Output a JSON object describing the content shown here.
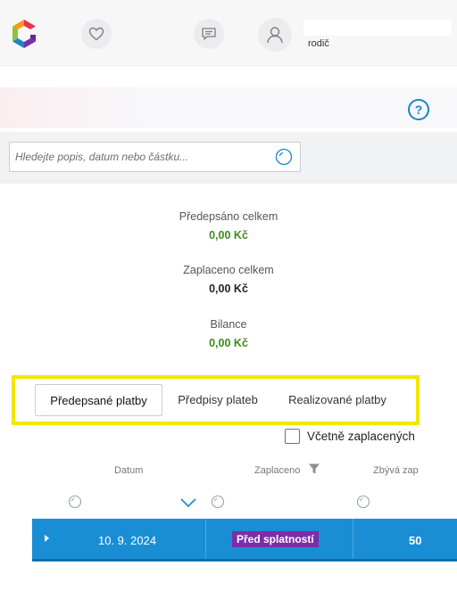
{
  "header": {
    "user_role": "rodič",
    "brand_colors": [
      "#e8334a",
      "#f39a1e",
      "#8bc53f",
      "#1a86c8",
      "#7c2ea8"
    ]
  },
  "panel": {
    "help_symbol": "?"
  },
  "search": {
    "placeholder": "Hledejte popis, datum nebo částku..."
  },
  "summary": {
    "prescribed_label": "Předepsáno celkem",
    "prescribed_value": "0,00 Kč",
    "paid_label": "Zaplaceno celkem",
    "paid_value": "0,00 Kč",
    "balance_label": "Bilance",
    "balance_value": "0,00 Kč"
  },
  "tabs": [
    {
      "label": "Předepsané platby",
      "active": true
    },
    {
      "label": "Předpisy plateb",
      "active": false
    },
    {
      "label": "Realizované platby",
      "active": false
    }
  ],
  "filter": {
    "include_paid_label": "Včetně zaplacených",
    "checked": false
  },
  "table": {
    "columns": [
      "Datum",
      "Zaplaceno",
      "Zbývá zap"
    ],
    "rows": [
      {
        "date": "10. 9. 2024",
        "status": "Před splatností",
        "amount": "50"
      }
    ]
  },
  "colors": {
    "accent": "#1a86c8",
    "row_bg": "#1a8ed4",
    "status_badge": "#7c2ea8",
    "highlight": "#f2e600",
    "money_green": "#3f8a1e"
  }
}
